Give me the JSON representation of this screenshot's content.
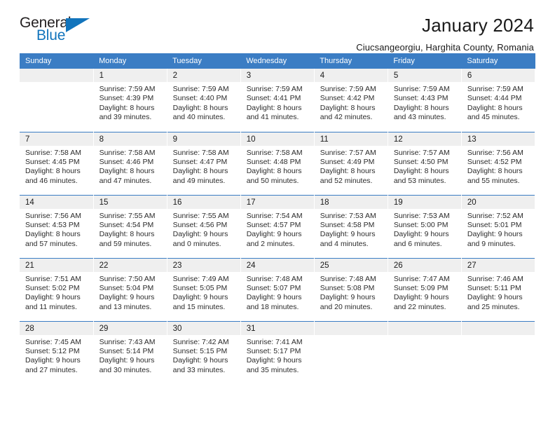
{
  "logo": {
    "word_top": "General",
    "word_bottom": "Blue",
    "triangle_icon": "triangle-icon",
    "accent_color": "#1274bc"
  },
  "header": {
    "title": "January 2024",
    "subtitle": "Ciucsangeorgiu, Harghita County, Romania"
  },
  "calendar": {
    "header_color": "#3b7dc4",
    "daynum_bg": "#efefef",
    "weekdays": [
      "Sunday",
      "Monday",
      "Tuesday",
      "Wednesday",
      "Thursday",
      "Friday",
      "Saturday"
    ],
    "weeks": [
      [
        {
          "day": "",
          "lines": []
        },
        {
          "day": "1",
          "lines": [
            "Sunrise: 7:59 AM",
            "Sunset: 4:39 PM",
            "Daylight: 8 hours",
            "and 39 minutes."
          ]
        },
        {
          "day": "2",
          "lines": [
            "Sunrise: 7:59 AM",
            "Sunset: 4:40 PM",
            "Daylight: 8 hours",
            "and 40 minutes."
          ]
        },
        {
          "day": "3",
          "lines": [
            "Sunrise: 7:59 AM",
            "Sunset: 4:41 PM",
            "Daylight: 8 hours",
            "and 41 minutes."
          ]
        },
        {
          "day": "4",
          "lines": [
            "Sunrise: 7:59 AM",
            "Sunset: 4:42 PM",
            "Daylight: 8 hours",
            "and 42 minutes."
          ]
        },
        {
          "day": "5",
          "lines": [
            "Sunrise: 7:59 AM",
            "Sunset: 4:43 PM",
            "Daylight: 8 hours",
            "and 43 minutes."
          ]
        },
        {
          "day": "6",
          "lines": [
            "Sunrise: 7:59 AM",
            "Sunset: 4:44 PM",
            "Daylight: 8 hours",
            "and 45 minutes."
          ]
        }
      ],
      [
        {
          "day": "7",
          "lines": [
            "Sunrise: 7:58 AM",
            "Sunset: 4:45 PM",
            "Daylight: 8 hours",
            "and 46 minutes."
          ]
        },
        {
          "day": "8",
          "lines": [
            "Sunrise: 7:58 AM",
            "Sunset: 4:46 PM",
            "Daylight: 8 hours",
            "and 47 minutes."
          ]
        },
        {
          "day": "9",
          "lines": [
            "Sunrise: 7:58 AM",
            "Sunset: 4:47 PM",
            "Daylight: 8 hours",
            "and 49 minutes."
          ]
        },
        {
          "day": "10",
          "lines": [
            "Sunrise: 7:58 AM",
            "Sunset: 4:48 PM",
            "Daylight: 8 hours",
            "and 50 minutes."
          ]
        },
        {
          "day": "11",
          "lines": [
            "Sunrise: 7:57 AM",
            "Sunset: 4:49 PM",
            "Daylight: 8 hours",
            "and 52 minutes."
          ]
        },
        {
          "day": "12",
          "lines": [
            "Sunrise: 7:57 AM",
            "Sunset: 4:50 PM",
            "Daylight: 8 hours",
            "and 53 minutes."
          ]
        },
        {
          "day": "13",
          "lines": [
            "Sunrise: 7:56 AM",
            "Sunset: 4:52 PM",
            "Daylight: 8 hours",
            "and 55 minutes."
          ]
        }
      ],
      [
        {
          "day": "14",
          "lines": [
            "Sunrise: 7:56 AM",
            "Sunset: 4:53 PM",
            "Daylight: 8 hours",
            "and 57 minutes."
          ]
        },
        {
          "day": "15",
          "lines": [
            "Sunrise: 7:55 AM",
            "Sunset: 4:54 PM",
            "Daylight: 8 hours",
            "and 59 minutes."
          ]
        },
        {
          "day": "16",
          "lines": [
            "Sunrise: 7:55 AM",
            "Sunset: 4:56 PM",
            "Daylight: 9 hours",
            "and 0 minutes."
          ]
        },
        {
          "day": "17",
          "lines": [
            "Sunrise: 7:54 AM",
            "Sunset: 4:57 PM",
            "Daylight: 9 hours",
            "and 2 minutes."
          ]
        },
        {
          "day": "18",
          "lines": [
            "Sunrise: 7:53 AM",
            "Sunset: 4:58 PM",
            "Daylight: 9 hours",
            "and 4 minutes."
          ]
        },
        {
          "day": "19",
          "lines": [
            "Sunrise: 7:53 AM",
            "Sunset: 5:00 PM",
            "Daylight: 9 hours",
            "and 6 minutes."
          ]
        },
        {
          "day": "20",
          "lines": [
            "Sunrise: 7:52 AM",
            "Sunset: 5:01 PM",
            "Daylight: 9 hours",
            "and 9 minutes."
          ]
        }
      ],
      [
        {
          "day": "21",
          "lines": [
            "Sunrise: 7:51 AM",
            "Sunset: 5:02 PM",
            "Daylight: 9 hours",
            "and 11 minutes."
          ]
        },
        {
          "day": "22",
          "lines": [
            "Sunrise: 7:50 AM",
            "Sunset: 5:04 PM",
            "Daylight: 9 hours",
            "and 13 minutes."
          ]
        },
        {
          "day": "23",
          "lines": [
            "Sunrise: 7:49 AM",
            "Sunset: 5:05 PM",
            "Daylight: 9 hours",
            "and 15 minutes."
          ]
        },
        {
          "day": "24",
          "lines": [
            "Sunrise: 7:48 AM",
            "Sunset: 5:07 PM",
            "Daylight: 9 hours",
            "and 18 minutes."
          ]
        },
        {
          "day": "25",
          "lines": [
            "Sunrise: 7:48 AM",
            "Sunset: 5:08 PM",
            "Daylight: 9 hours",
            "and 20 minutes."
          ]
        },
        {
          "day": "26",
          "lines": [
            "Sunrise: 7:47 AM",
            "Sunset: 5:09 PM",
            "Daylight: 9 hours",
            "and 22 minutes."
          ]
        },
        {
          "day": "27",
          "lines": [
            "Sunrise: 7:46 AM",
            "Sunset: 5:11 PM",
            "Daylight: 9 hours",
            "and 25 minutes."
          ]
        }
      ],
      [
        {
          "day": "28",
          "lines": [
            "Sunrise: 7:45 AM",
            "Sunset: 5:12 PM",
            "Daylight: 9 hours",
            "and 27 minutes."
          ]
        },
        {
          "day": "29",
          "lines": [
            "Sunrise: 7:43 AM",
            "Sunset: 5:14 PM",
            "Daylight: 9 hours",
            "and 30 minutes."
          ]
        },
        {
          "day": "30",
          "lines": [
            "Sunrise: 7:42 AM",
            "Sunset: 5:15 PM",
            "Daylight: 9 hours",
            "and 33 minutes."
          ]
        },
        {
          "day": "31",
          "lines": [
            "Sunrise: 7:41 AM",
            "Sunset: 5:17 PM",
            "Daylight: 9 hours",
            "and 35 minutes."
          ]
        },
        {
          "day": "",
          "lines": []
        },
        {
          "day": "",
          "lines": []
        },
        {
          "day": "",
          "lines": []
        }
      ]
    ]
  }
}
